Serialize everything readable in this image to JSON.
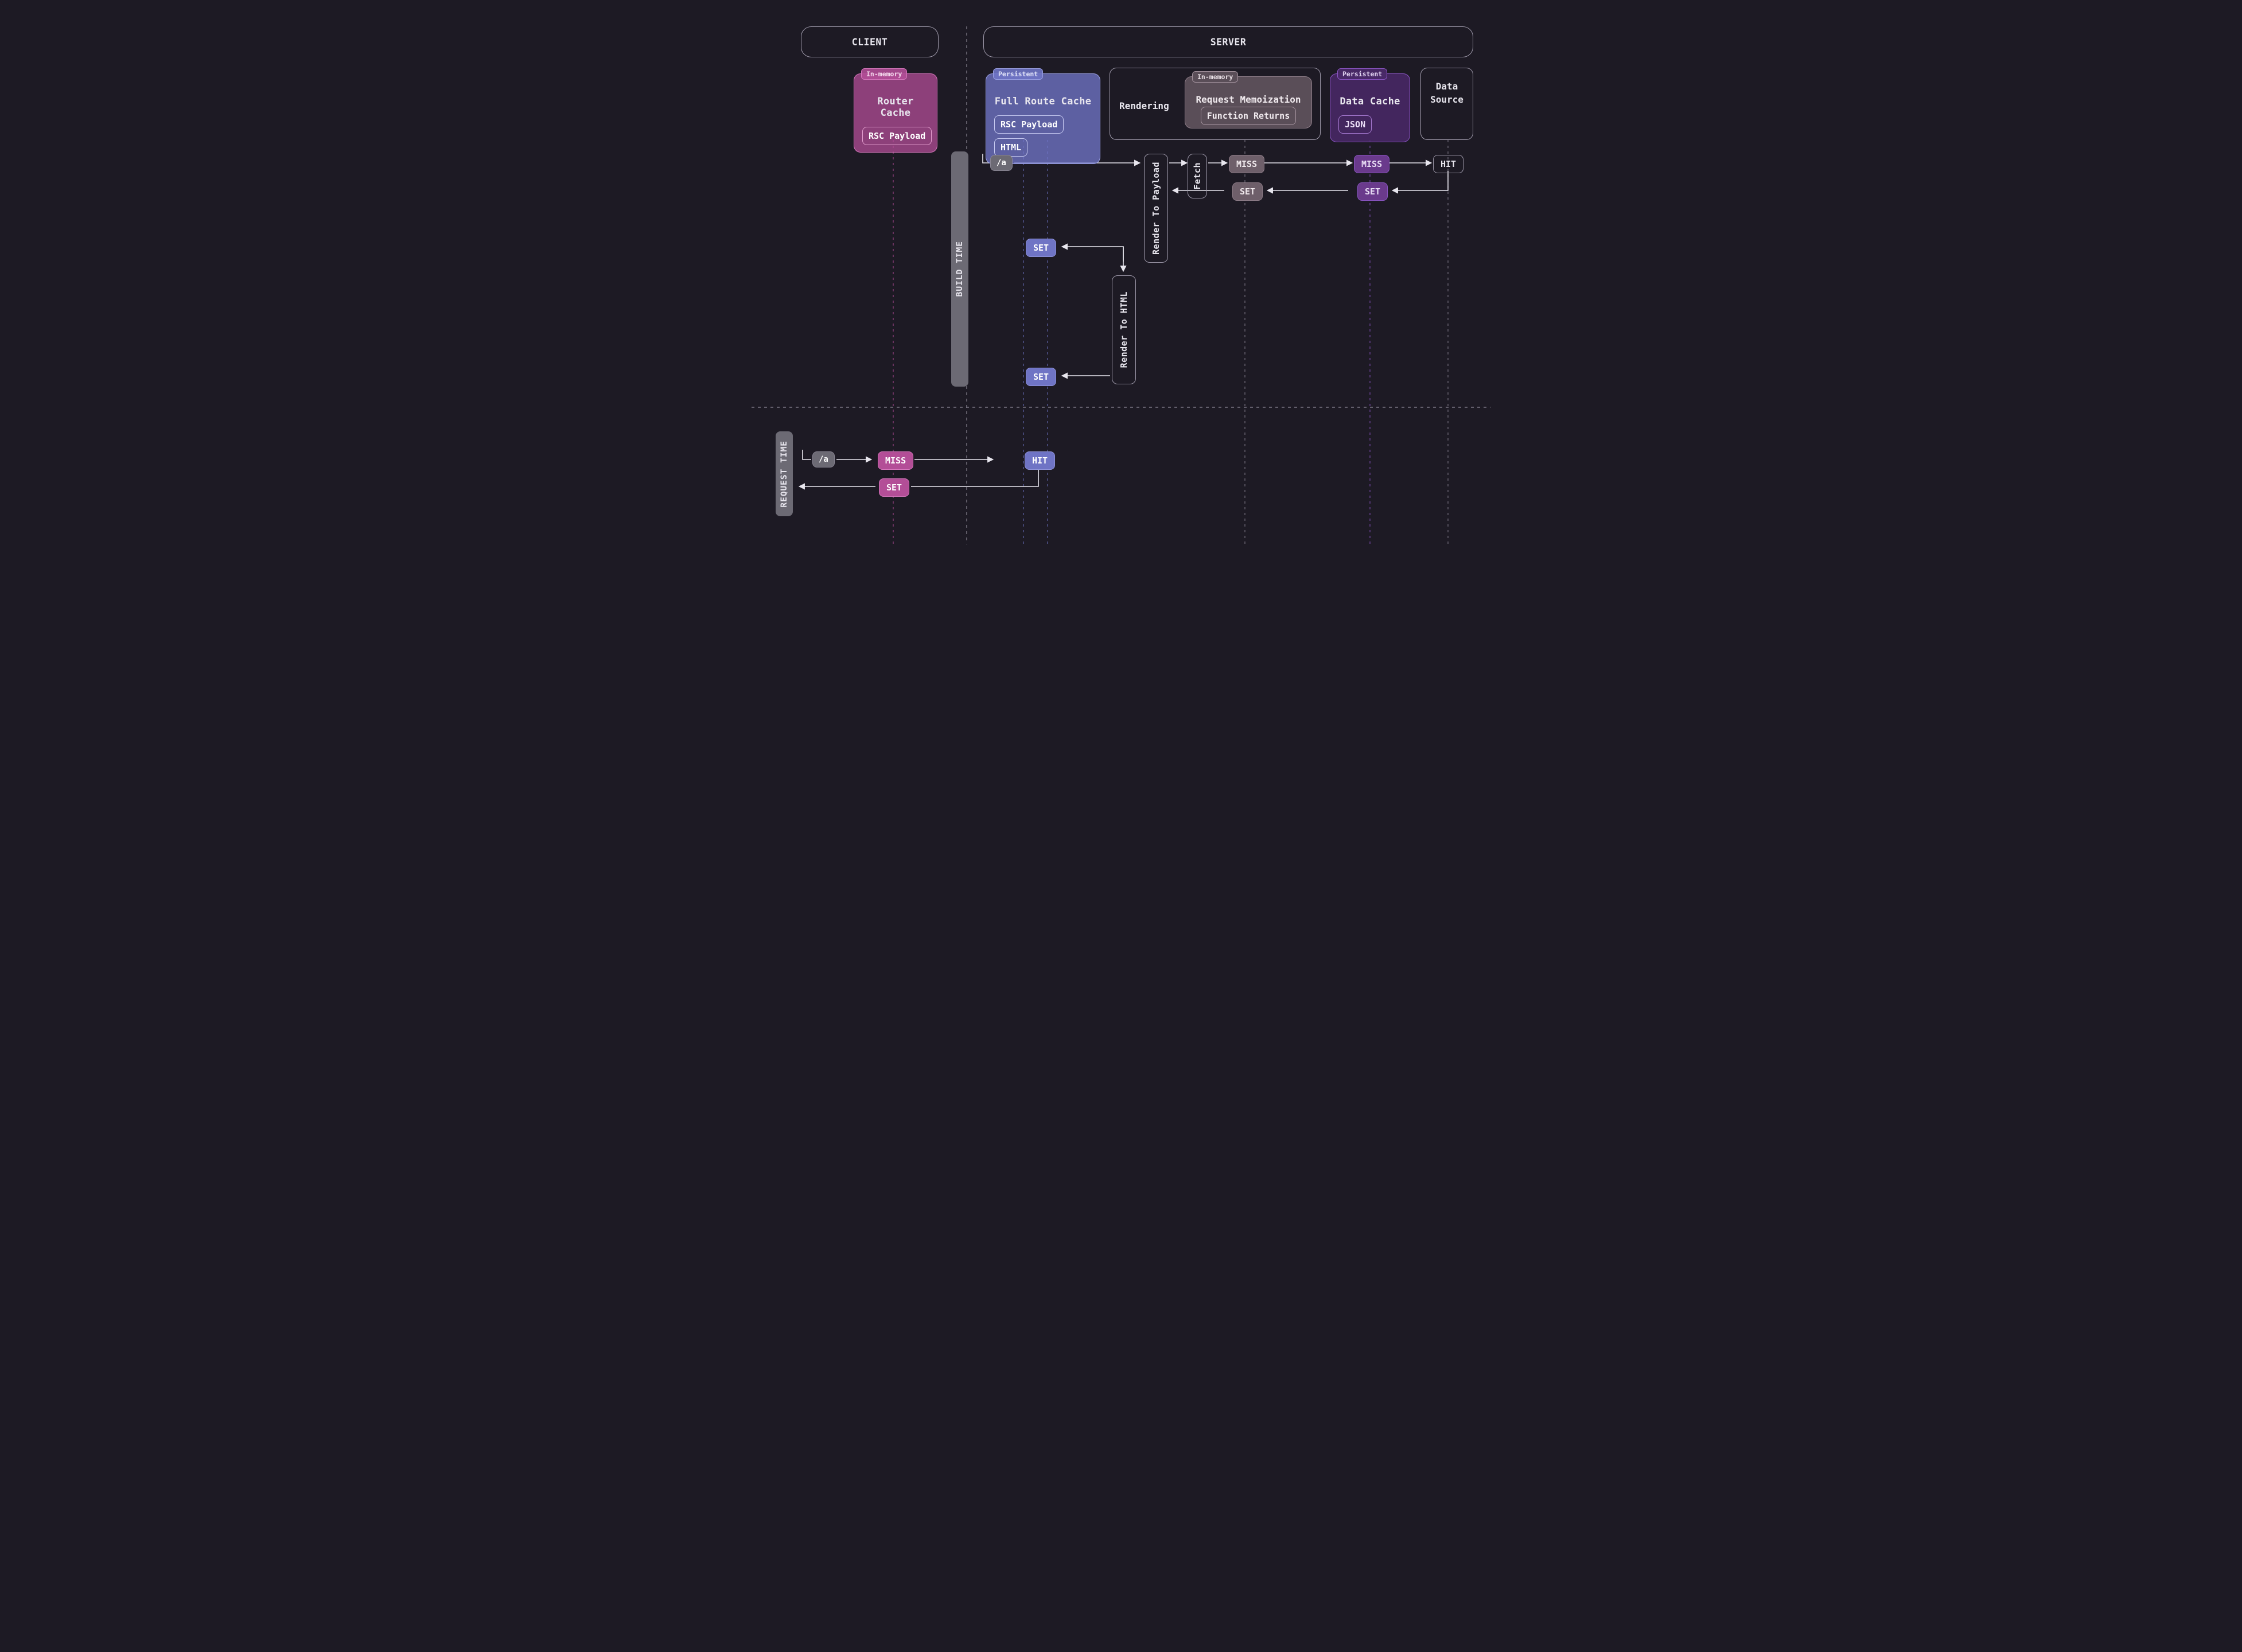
{
  "header": {
    "client": "CLIENT",
    "server": "SERVER"
  },
  "cards": {
    "router": {
      "storage": "In-memory",
      "title": "Router Cache",
      "chips": [
        "RSC Payload"
      ]
    },
    "full_route": {
      "storage": "Persistent",
      "title": "Full Route Cache",
      "chips": [
        "RSC Payload",
        "HTML"
      ]
    },
    "rendering": {
      "label": "Rendering"
    },
    "memo": {
      "storage": "In-memory",
      "title": "Request Memoization",
      "chips": [
        "Function Returns"
      ]
    },
    "data_cache": {
      "storage": "Persistent",
      "title": "Data Cache",
      "chips": [
        "JSON"
      ]
    },
    "data_source": {
      "line1": "Data",
      "line2": "Source"
    }
  },
  "phases": {
    "build": "BUILD TIME",
    "request": "REQUEST TIME"
  },
  "proc": {
    "render_payload": "Render To Payload",
    "render_html": "Render To HTML",
    "fetch": "Fetch"
  },
  "tags": {
    "route": "/a",
    "miss": "MISS",
    "hit": "HIT",
    "set": "SET"
  }
}
